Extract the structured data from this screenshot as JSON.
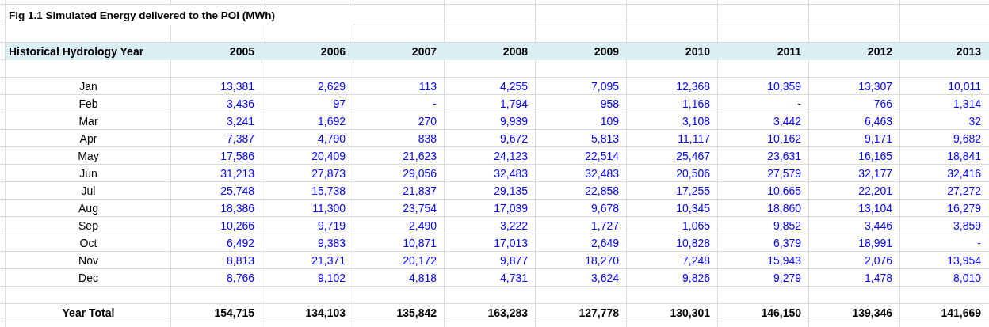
{
  "title": "Fig 1.1 Simulated Energy delivered to the POI (MWh)",
  "header": {
    "label": "Historical Hydrology Year",
    "years": [
      "2005",
      "2006",
      "2007",
      "2008",
      "2009",
      "2010",
      "2011",
      "2012",
      "2013"
    ]
  },
  "rows": [
    {
      "month": "Jan",
      "values": [
        "13,381",
        "2,629",
        "113",
        "4,255",
        "7,095",
        "12,368",
        "10,359",
        "13,307",
        "10,011"
      ]
    },
    {
      "month": "Feb",
      "values": [
        "3,436",
        "97",
        "-",
        "1,794",
        "958",
        "1,168",
        "-",
        "766",
        "1,314"
      ]
    },
    {
      "month": "Mar",
      "values": [
        "3,241",
        "1,692",
        "270",
        "9,939",
        "109",
        "3,108",
        "3,442",
        "6,463",
        "32"
      ]
    },
    {
      "month": "Apr",
      "values": [
        "7,387",
        "4,790",
        "838",
        "9,672",
        "5,813",
        "11,117",
        "10,162",
        "9,171",
        "9,682"
      ]
    },
    {
      "month": "May",
      "values": [
        "17,586",
        "20,409",
        "21,623",
        "24,123",
        "22,514",
        "25,467",
        "23,631",
        "16,165",
        "18,841"
      ]
    },
    {
      "month": "Jun",
      "values": [
        "31,213",
        "27,873",
        "29,056",
        "32,483",
        "32,483",
        "20,506",
        "27,579",
        "32,177",
        "32,416"
      ]
    },
    {
      "month": "Jul",
      "values": [
        "25,748",
        "15,738",
        "21,837",
        "29,135",
        "22,858",
        "17,255",
        "10,665",
        "22,201",
        "27,272"
      ]
    },
    {
      "month": "Aug",
      "values": [
        "18,386",
        "11,300",
        "23,754",
        "17,039",
        "9,678",
        "10,345",
        "18,860",
        "13,104",
        "16,279"
      ]
    },
    {
      "month": "Sep",
      "values": [
        "10,266",
        "9,719",
        "2,490",
        "3,222",
        "1,727",
        "1,065",
        "9,852",
        "3,446",
        "3,859"
      ]
    },
    {
      "month": "Oct",
      "values": [
        "6,492",
        "9,383",
        "10,871",
        "17,013",
        "2,649",
        "10,828",
        "6,379",
        "18,991",
        "-"
      ]
    },
    {
      "month": "Nov",
      "values": [
        "8,813",
        "21,371",
        "20,172",
        "9,877",
        "18,270",
        "7,248",
        "15,943",
        "2,076",
        "13,954"
      ]
    },
    {
      "month": "Dec",
      "values": [
        "8,766",
        "9,102",
        "4,818",
        "4,731",
        "3,624",
        "9,826",
        "9,279",
        "1,478",
        "8,010"
      ]
    }
  ],
  "total": {
    "label": "Year Total",
    "values": [
      "154,715",
      "134,103",
      "135,842",
      "163,283",
      "127,778",
      "130,301",
      "146,150",
      "139,346",
      "141,669"
    ]
  }
}
